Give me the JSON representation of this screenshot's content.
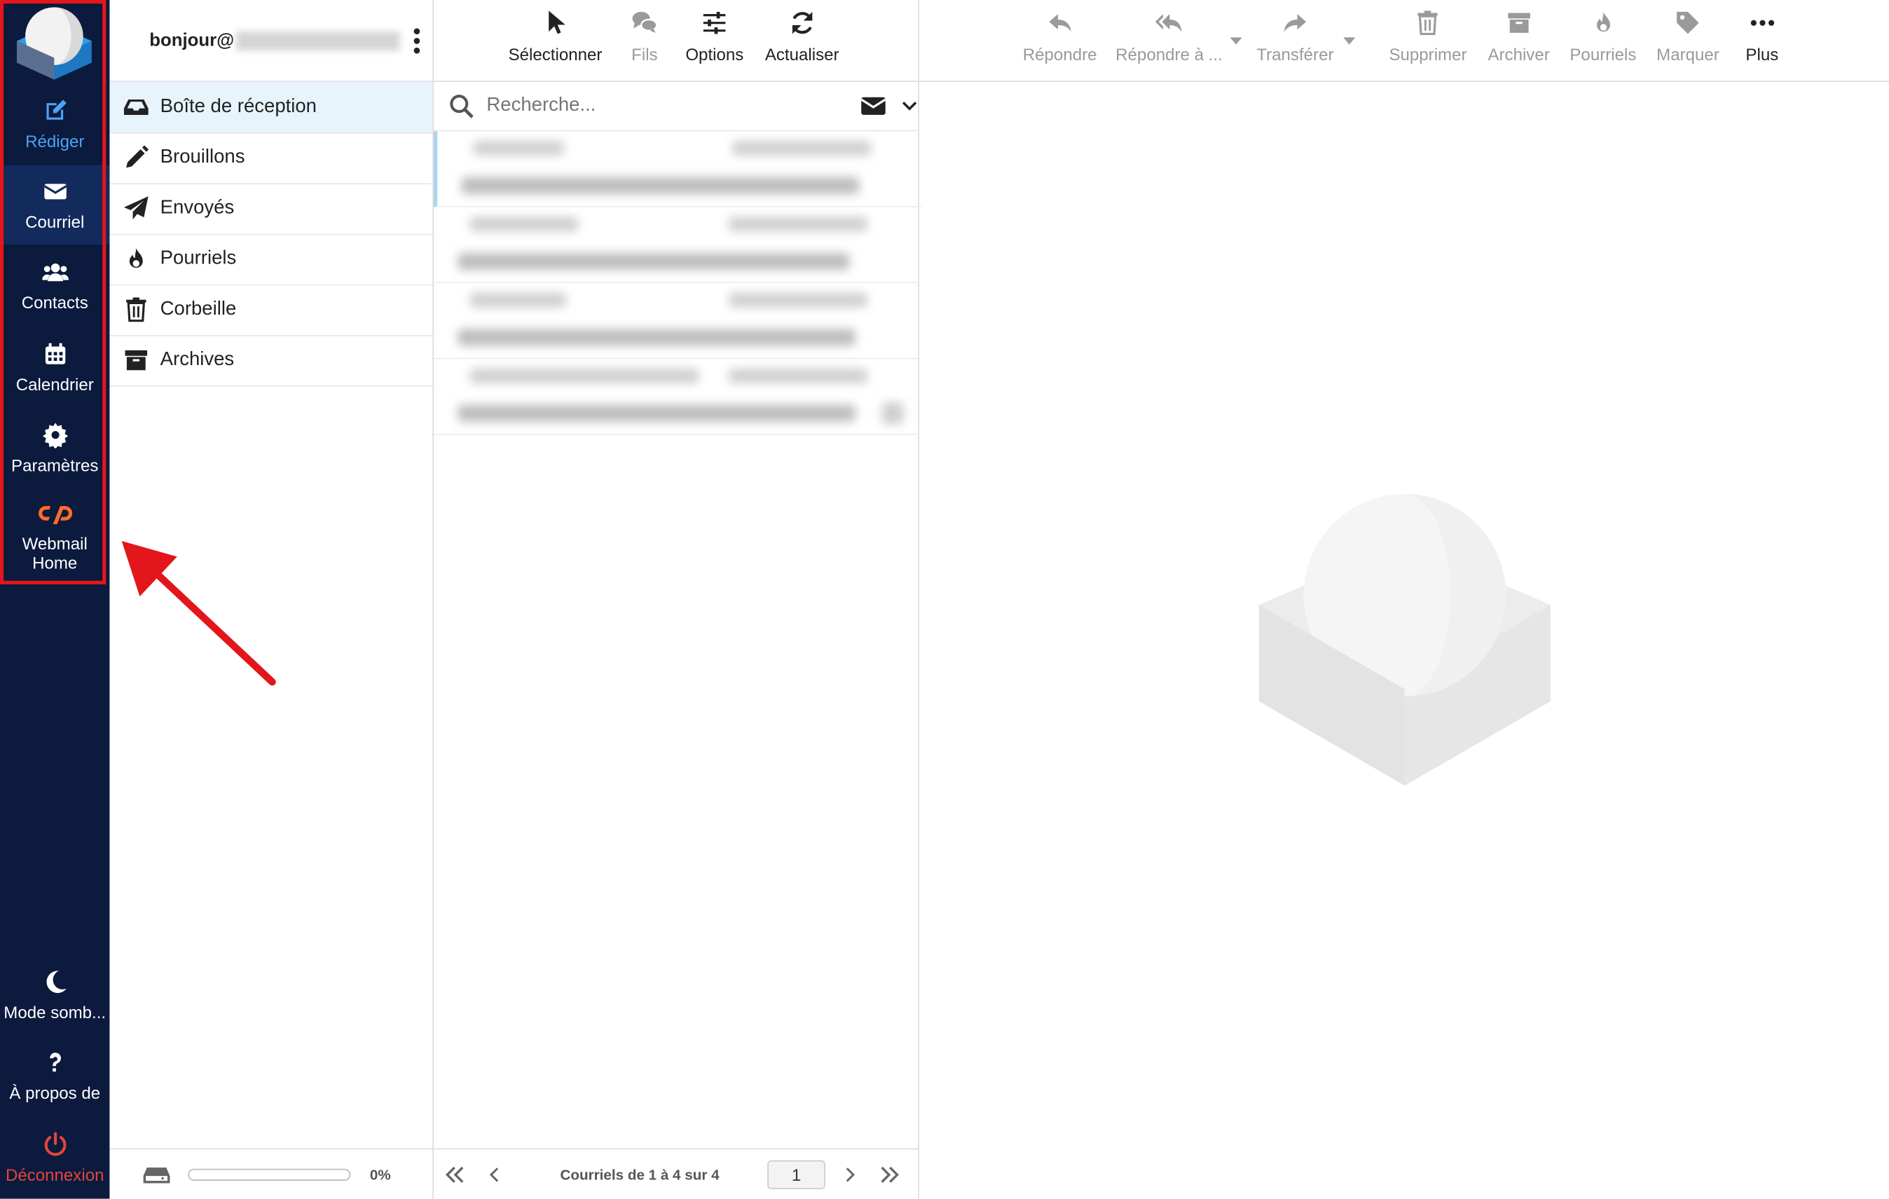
{
  "nav": {
    "compose": "Rédiger",
    "mail": "Courriel",
    "contacts": "Contacts",
    "calendar": "Calendrier",
    "settings": "Paramètres",
    "webmail_home": "Webmail Home",
    "dark_mode": "Mode somb...",
    "about": "À propos de",
    "logout": "Déconnexion"
  },
  "account": {
    "user_prefix": "bonjour@"
  },
  "folders": [
    {
      "label": "Boîte de réception",
      "icon": "inbox-icon"
    },
    {
      "label": "Brouillons",
      "icon": "pencil-icon"
    },
    {
      "label": "Envoyés",
      "icon": "paper-plane-icon"
    },
    {
      "label": "Pourriels",
      "icon": "fire-icon"
    },
    {
      "label": "Corbeille",
      "icon": "trash-icon"
    },
    {
      "label": "Archives",
      "icon": "archive-icon"
    }
  ],
  "quota": {
    "percent_label": "0%",
    "used_fraction": 0
  },
  "list_toolbar": {
    "select": "Sélectionner",
    "threads": "Fils",
    "options": "Options",
    "refresh": "Actualiser"
  },
  "search": {
    "placeholder": "Recherche..."
  },
  "pager": {
    "info": "Courriels de 1 à 4 sur 4",
    "page": "1"
  },
  "message_toolbar": {
    "reply": "Répondre",
    "reply_all": "Répondre à ...",
    "forward": "Transférer",
    "delete": "Supprimer",
    "archive": "Archiver",
    "spam": "Pourriels",
    "mark": "Marquer",
    "more": "Plus"
  },
  "colors": {
    "nav_bg": "#0b1a3d",
    "nav_active": "#132a5c",
    "compose_accent": "#4aa3f5",
    "logout": "#e5453b",
    "cpanel_orange": "#ff6c2c",
    "highlight_red": "#e3161b",
    "selected_folder_bg": "#e7f4fc"
  }
}
